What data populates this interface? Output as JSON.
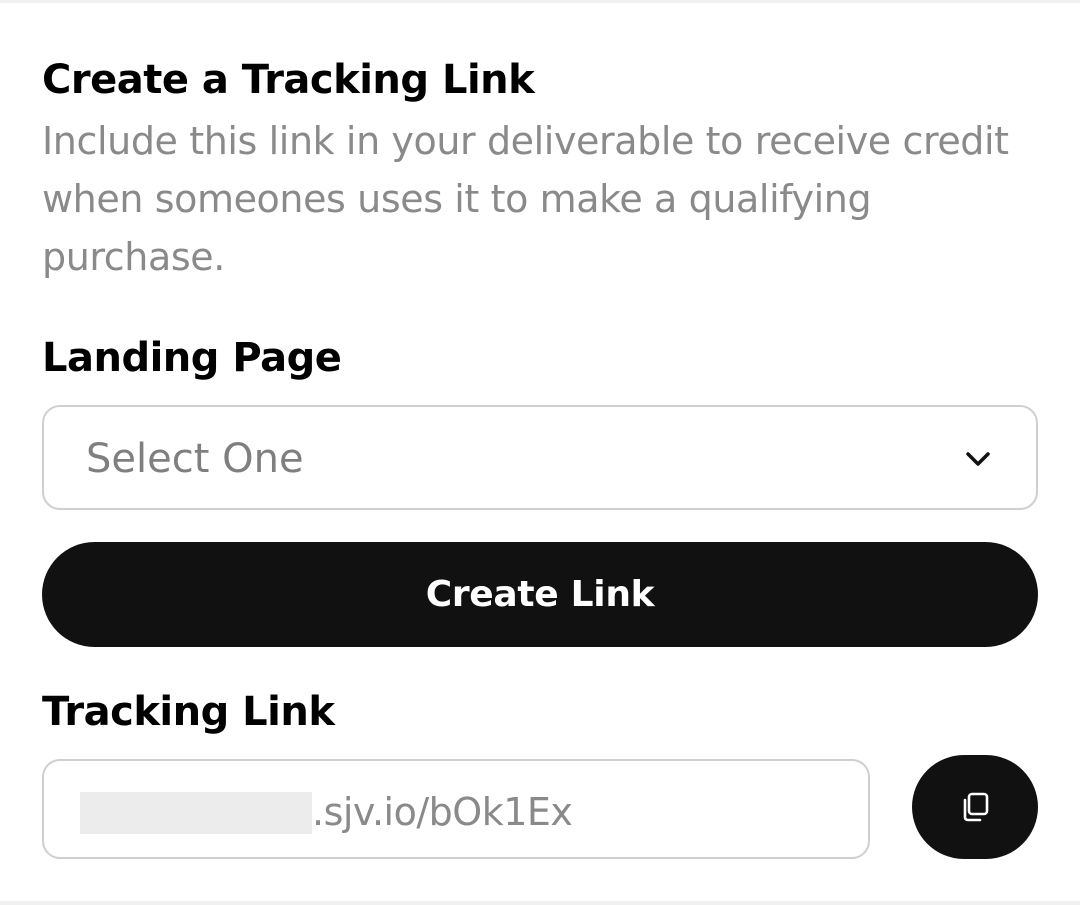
{
  "section": {
    "title": "Create a Tracking Link",
    "description": "Include this link in your deliverable to receive credit when someones uses it to make a qualifying purchase."
  },
  "landing_page": {
    "label": "Landing Page",
    "selected": "Select One",
    "icon": "chevron-down-icon"
  },
  "create_button": {
    "label": "Create Link"
  },
  "tracking_link": {
    "label": "Tracking Link",
    "value_visible": ".sjv.io/bOk1Ex",
    "copy_icon": "copy-icon"
  },
  "colors": {
    "primary": "#111111",
    "muted_text": "#8a8a8a",
    "border": "#cfcfcf",
    "redaction": "#ececec"
  }
}
